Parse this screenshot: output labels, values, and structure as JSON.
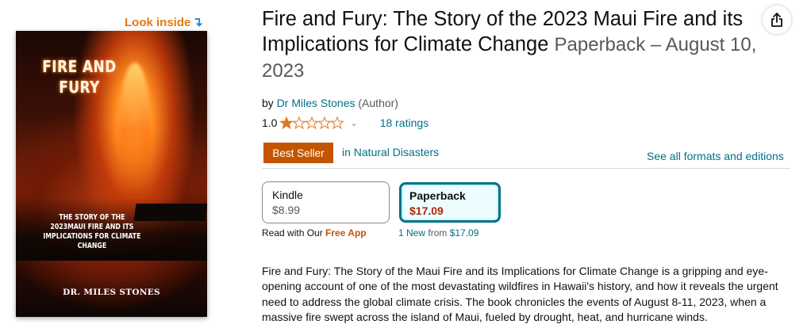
{
  "look_inside": {
    "label": "Look inside",
    "arrow": "↴"
  },
  "cover": {
    "title_line1": "FIRE AND",
    "title_line2": "FURY",
    "subtitle_line1": "THE STORY OF THE",
    "subtitle_line2": "2023MAUI FIRE AND ITS",
    "subtitle_line3": "IMPLICATIONS FOR CLIMATE",
    "subtitle_line4": "CHANGE",
    "author": "DR. MILES STONES"
  },
  "product": {
    "title": "Fire and Fury: The Story of the 2023 Maui Fire and its Implications for Climate Change",
    "format_date": "Paperback – August 10, 2023",
    "by_label": "by",
    "author": "Dr Miles Stones",
    "author_role": "(Author)",
    "rating": "1.0",
    "stars_filled": 1,
    "stars_total": 5,
    "ratings_count": "18 ratings",
    "badge": "Best Seller",
    "category": "in Natural Disasters",
    "see_all_formats": "See all formats and editions"
  },
  "formats": [
    {
      "name": "Kindle",
      "price": "$8.99",
      "selected": false
    },
    {
      "name": "Paperback",
      "price": "$17.09",
      "selected": true
    }
  ],
  "kindle_note": {
    "prefix": "Read with Our",
    "link": "Free App"
  },
  "paperback_note": {
    "new_count": "1 New",
    "from": "from",
    "price": "$17.09"
  },
  "description": "Fire and Fury: The Story of the Maui Fire and its Implications for Climate Change is a gripping and eye-opening account of one of the most devastating wildfires in Hawaii's history, and how it reveals the urgent need to address the global climate crisis. The book chronicles the events of August 8-11, 2023, when a massive fire swept across the island of Maui, fueled by drought, heat, and hurricane winds.",
  "colors": {
    "link": "#007185",
    "badge": "#c45500",
    "price": "#b12704",
    "star": "#de7921",
    "look_inside": "#e47911"
  },
  "icons": {
    "share": "share-icon",
    "star": "star-icon",
    "chevron": "chevron-down-icon"
  }
}
